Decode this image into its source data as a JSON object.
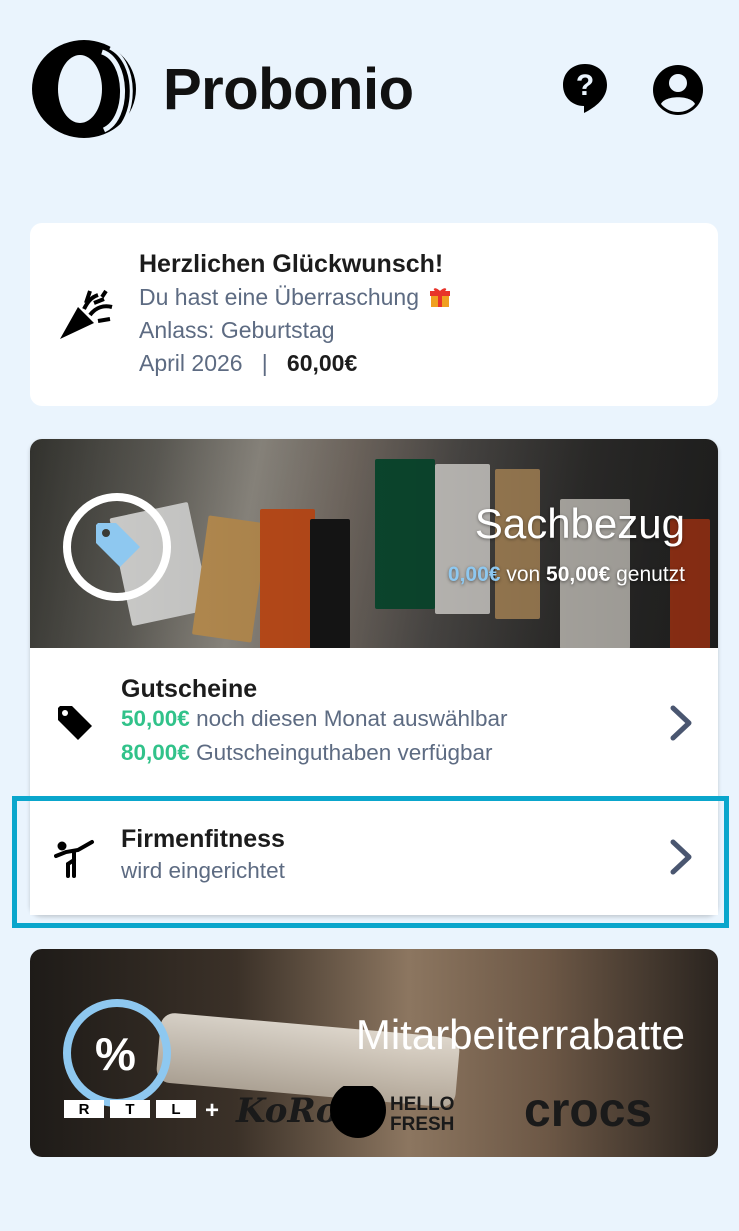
{
  "header": {
    "brand": "Probonio"
  },
  "congrats": {
    "title": "Herzlichen Glückwunsch!",
    "line1": "Du hast eine Überraschung",
    "line2": "Anlass: Geburtstag",
    "date": "April 2026",
    "separator": "|",
    "amount": "60,00€"
  },
  "sachbezug": {
    "title": "Sachbezug",
    "used": "0,00€",
    "of_text": "von",
    "total": "50,00€",
    "used_text": "genutzt"
  },
  "gutscheine": {
    "title": "Gutscheine",
    "amount1": "50,00€",
    "text1": "noch diesen Monat auswählbar",
    "amount2": "80,00€",
    "text2": "Gutscheinguthaben verfügbar"
  },
  "firmenfitness": {
    "title": "Firmenfitness",
    "subtitle": "wird eingerichtet"
  },
  "rabatte": {
    "title": "Mitarbeiterrabatte",
    "symbol": "%",
    "partners": [
      "RTL+",
      "KoRo",
      "HELLO FRESH",
      "crocs"
    ]
  },
  "colors": {
    "background": "#eaf4fd",
    "accent_green": "#31c28a",
    "accent_lightblue": "#8ec8f0",
    "highlight": "#0aa6cc",
    "muted_text": "#5d6b82"
  }
}
